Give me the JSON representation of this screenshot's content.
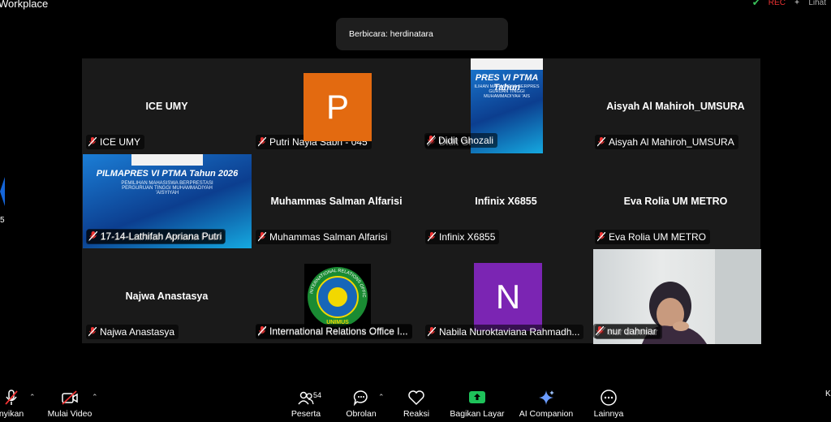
{
  "window": {
    "title": "Workplace"
  },
  "top_right": {
    "rec": "REC",
    "view": "Lihat"
  },
  "speaker": {
    "text": "Berbicara: herdinatara"
  },
  "edge": {
    "number": "5"
  },
  "tiles": [
    {
      "name": "ICE UMY",
      "center": "ICE UMY"
    },
    {
      "name": "Putri Nayla Sabri - 045",
      "avatar": "P"
    },
    {
      "name": "Didit Ghozali",
      "poster": {
        "title": "PRES VI PTMA Tahun",
        "sub": "ILIHAN MAHASISWA BERPRES GURUAN TINGGI MUHAMMADIYAH 'AIS"
      }
    },
    {
      "name": "Aisyah Al Mahiroh_UMSURA",
      "center": "Aisyah Al Mahiroh_UMSURA"
    },
    {
      "name": "17-14-Lathifah Apriana Putri",
      "poster": {
        "title": "PILMAPRES VI PTMA Tahun 2026",
        "sub": "PEMILIHAN MAHASISWA BERPRESTASI PERGURUAN TINGGI MUHAMMADIYAH 'AISYIYAH"
      }
    },
    {
      "name": "Muhammas Salman Alfarisi",
      "center": "Muhammas Salman Alfarisi"
    },
    {
      "name": "Infinix X6855",
      "center": "Infinix X6855"
    },
    {
      "name": "Eva Rolia UM METRO",
      "center": "Eva Rolia UM METRO"
    },
    {
      "name": "Najwa Anastasya",
      "center": "Najwa Anastasya"
    },
    {
      "name": "International Relations Office I...",
      "logo": {
        "ring": "INTERNATIONAL RELATIONS OFFICE",
        "bottom": "UNIMUS"
      }
    },
    {
      "name": "Nabila Nuroktaviana Rahmadh...",
      "avatar": "N"
    },
    {
      "name": "nur dahniar",
      "video": true
    }
  ],
  "toolbar": {
    "mic": "nyikan",
    "video": "Mulai Video",
    "participants": "Peserta",
    "participants_count": "54",
    "chat": "Obrolan",
    "react": "Reaksi",
    "share": "Bagikan Layar",
    "ai": "AI Companion",
    "more": "Lainnya",
    "end": "K"
  }
}
